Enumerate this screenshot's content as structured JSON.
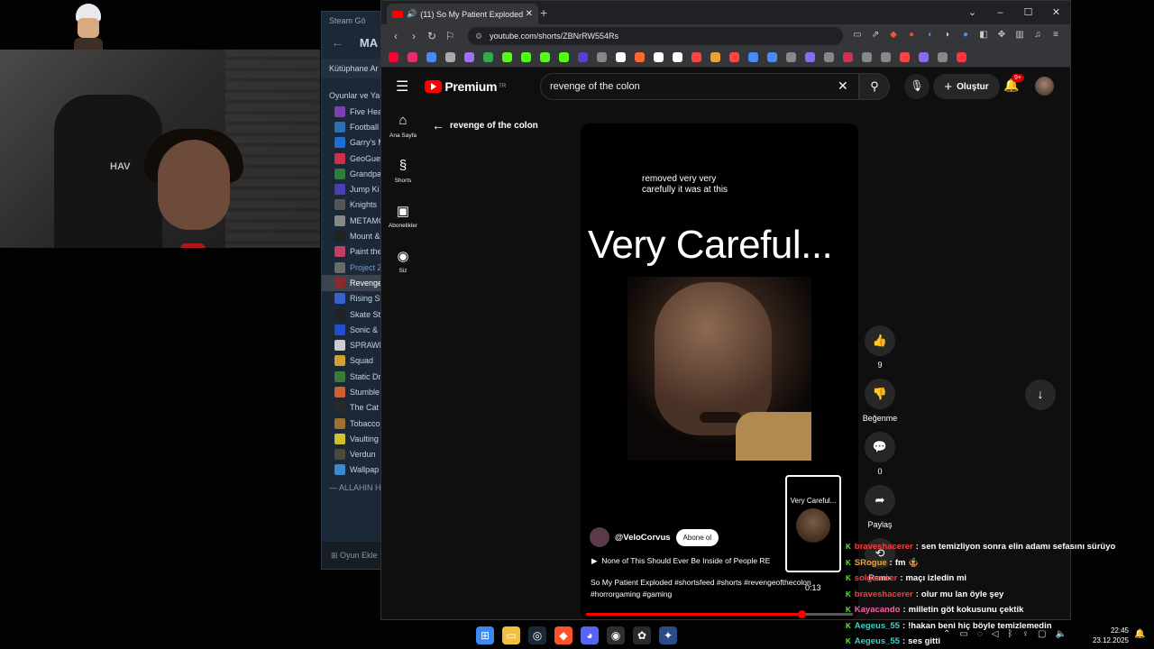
{
  "steam": {
    "topbar": "Steam  Gö",
    "nav_title": "MA",
    "library_label": "Kütüphane Ar",
    "section_label": "Oyunlar ve Ya",
    "games": [
      {
        "name": "Five Hea",
        "color": "#7b3fb0"
      },
      {
        "name": "Football",
        "color": "#2e6fb0"
      },
      {
        "name": "Garry's M",
        "color": "#1f6fd0"
      },
      {
        "name": "GeoGues",
        "color": "#d03050"
      },
      {
        "name": "Grandpa",
        "color": "#2f7d3c"
      },
      {
        "name": "Jump Ki",
        "color": "#4a3fb0"
      },
      {
        "name": "Knights",
        "color": "#555555"
      },
      {
        "name": "METAMO",
        "color": "#888888"
      },
      {
        "name": "Mount &",
        "color": "#222222"
      },
      {
        "name": "Paint the",
        "color": "#c04060"
      },
      {
        "name": "Project Z",
        "color": "#6a6a6a"
      },
      {
        "name": "Revenge",
        "color": "#8a2a2a"
      },
      {
        "name": "Rising St",
        "color": "#3a5fd0"
      },
      {
        "name": "Skate St",
        "color": "#222222"
      },
      {
        "name": "Sonic &",
        "color": "#1f4fd0"
      },
      {
        "name": "SPRAWL",
        "color": "#cccccc"
      },
      {
        "name": "Squad",
        "color": "#d0a030"
      },
      {
        "name": "Static Dr",
        "color": "#3a7a3a"
      },
      {
        "name": "Stumble",
        "color": "#d06030"
      },
      {
        "name": "The Cat",
        "color": "#2a2a2a"
      },
      {
        "name": "Tobacco",
        "color": "#a07030"
      },
      {
        "name": "Vaulting",
        "color": "#d0c030"
      },
      {
        "name": "Verdun",
        "color": "#4a4a3a"
      },
      {
        "name": "Wallpap",
        "color": "#3a8ad0"
      }
    ],
    "category": "— ALLAHIN HE",
    "add_game": "Oyun Ekle"
  },
  "browser": {
    "tab_title": "(11) So My Patient Exploded",
    "url": "youtube.com/shorts/ZBNrRW554Rs",
    "bookmark_colors": [
      "#ff0033",
      "#e1306c",
      "#4a8af4",
      "#aaaaaa",
      "#a070ff",
      "#34a853",
      "#53fc18",
      "#53fc18",
      "#53fc18",
      "#53fc18",
      "#5a3fd0",
      "#888888",
      "#ffffff",
      "#ff6633",
      "#ffffff",
      "#ffffff",
      "#ff4444",
      "#e8a040",
      "#ff4444",
      "#4a8af4",
      "#4a8af4",
      "#888888",
      "#8a6af4",
      "#888888",
      "#cc3355",
      "#888888",
      "#888888",
      "#ff4444",
      "#8a6af4",
      "#888888",
      "#ff3344"
    ]
  },
  "youtube": {
    "logo_text": "Premium",
    "region": "TR",
    "search_query": "revenge of the colon",
    "create_label": "Oluştur",
    "notif_badge": "9+",
    "rail": [
      {
        "icon": "home",
        "label": "Ana Sayfa"
      },
      {
        "icon": "shorts",
        "label": "Shorts"
      },
      {
        "icon": "subscriptions",
        "label": "Abonelikler"
      },
      {
        "icon": "you",
        "label": "Siz"
      }
    ],
    "back_label": "revenge of the colon",
    "short": {
      "subtitle": "removed very very carefully it was at this",
      "caption": "Very Careful...",
      "channel": "@VeloCorvus",
      "subscribe_label": "Abone ol",
      "song": "None of This Should Ever Be Inside of People RE",
      "title": "So My Patient Exploded #shortsfeed #shorts #revengeofthecolon #horrorgaming #gaming",
      "progress": 0.8
    },
    "preview": {
      "caption": "Very Careful...",
      "time": "0:13"
    },
    "actions": {
      "like_count": "9",
      "dislike_label": "Beğenme",
      "comment_count": "0",
      "share_label": "Paylaş",
      "remix_label": "Remix"
    }
  },
  "chat": [
    {
      "user": "braveshacerer",
      "color": "#ff3b3b",
      "msg": "sen temizliyon sonra elin adamı sefasını sürüyo"
    },
    {
      "user": "SRogue",
      "color": "#f0a030",
      "msg": "fm 🤹"
    },
    {
      "user": "solgameer",
      "color": "#ff3b3b",
      "msg": "maçı izledin mi"
    },
    {
      "user": "braveshacerer",
      "color": "#ff3b3b",
      "msg": "olur mu lan öyle şey"
    },
    {
      "user": "Kayacando",
      "color": "#ff5fae",
      "msg": "milletin göt kokusunu çektik"
    },
    {
      "user": "Aegeus_55",
      "color": "#3fd0c8",
      "msg": "!hakan beni hiç böyle temizlemedin"
    },
    {
      "user": "Aegeus_55",
      "color": "#3fd0c8",
      "msg": "ses gitti"
    }
  ],
  "taskbar": {
    "time": "22:45",
    "date": "23.12.2025"
  }
}
